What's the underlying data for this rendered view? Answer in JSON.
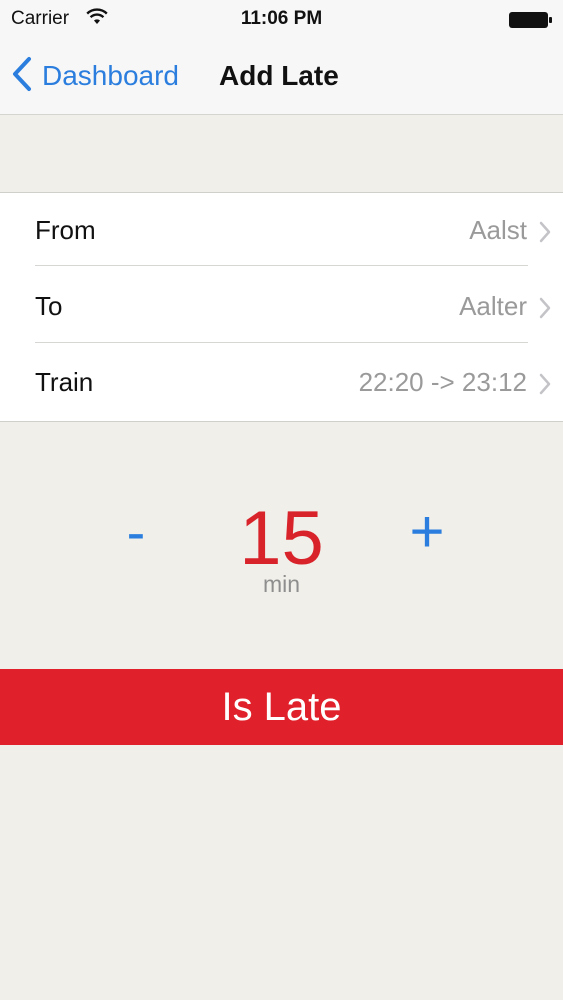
{
  "status_bar": {
    "carrier": "Carrier",
    "time": "11:06 PM"
  },
  "nav": {
    "back_label": "Dashboard",
    "title": "Add Late"
  },
  "form": {
    "rows": [
      {
        "label": "From",
        "value": "Aalst"
      },
      {
        "label": "To",
        "value": "Aalter"
      },
      {
        "label": "Train",
        "value": "22:20 -> 23:12"
      }
    ]
  },
  "stepper": {
    "minus_label": "-",
    "plus_label": "+",
    "value": "15",
    "unit": "min"
  },
  "action": {
    "label": "Is Late"
  },
  "colors": {
    "accent": "#2b7ede",
    "late_red": "#e0202a",
    "background": "#f0efe9"
  }
}
